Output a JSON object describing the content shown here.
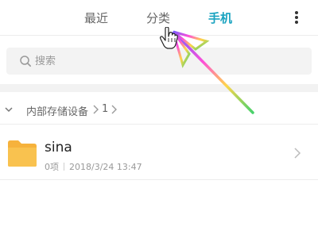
{
  "tabs": [
    {
      "label": "最近"
    },
    {
      "label": "分类"
    },
    {
      "label": "手机"
    }
  ],
  "active_tab": "手机",
  "search": {
    "placeholder": "搜索"
  },
  "breadcrumb": {
    "root": "内部存储设备",
    "current": "1"
  },
  "files": [
    {
      "name": "sina",
      "count": "0项",
      "modified": "2018/3/24 13:47",
      "icon": "folder-icon"
    }
  ],
  "colors": {
    "accent": "#1aa3c0",
    "folder": "#f6b23c"
  }
}
